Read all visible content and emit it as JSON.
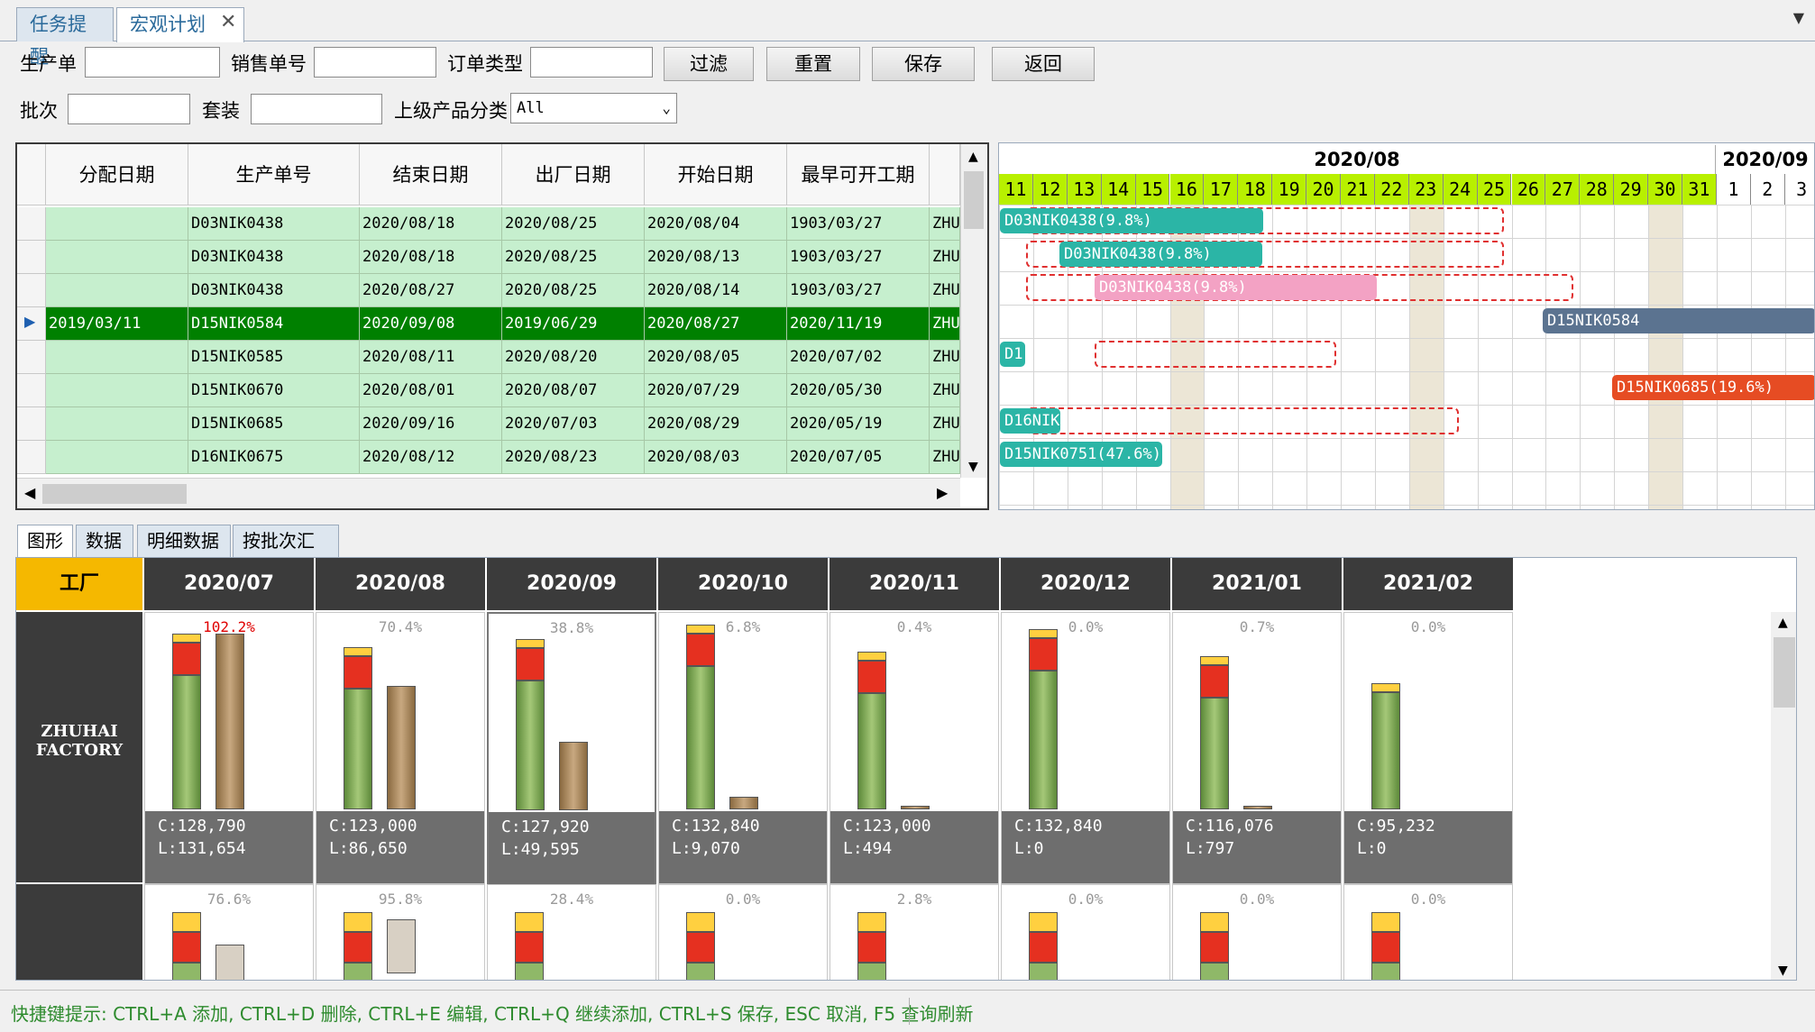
{
  "tabs": [
    {
      "label": "任务提醒"
    },
    {
      "label": "宏观计划"
    }
  ],
  "close_glyph": "✕",
  "filters": {
    "prod_label": "生产单",
    "sales_label": "销售单号",
    "ordertype_label": "订单类型",
    "batch_label": "批次",
    "suit_label": "套装",
    "category_label": "上级产品分类",
    "category_value": "All",
    "prod_value": "",
    "sales_value": "",
    "ordertype_value": "",
    "batch_value": "",
    "suit_value": ""
  },
  "buttons": {
    "filter": "过滤",
    "reset": "重置",
    "save": "保存",
    "back": "返回"
  },
  "grid": {
    "headers": [
      "分配日期",
      "生产单号",
      "结束日期",
      "出厂日期",
      "开始日期",
      "最早可开工期"
    ],
    "rows": [
      [
        "",
        "D03NIK0438",
        "2020/08/18",
        "2020/08/25",
        "2020/08/04",
        "1903/03/27",
        "ZHU"
      ],
      [
        "",
        "D03NIK0438",
        "2020/08/18",
        "2020/08/25",
        "2020/08/13",
        "1903/03/27",
        "ZHU"
      ],
      [
        "",
        "D03NIK0438",
        "2020/08/27",
        "2020/08/25",
        "2020/08/14",
        "1903/03/27",
        "ZHU"
      ],
      [
        "2019/03/11",
        "D15NIK0584",
        "2020/09/08",
        "2019/06/29",
        "2020/08/27",
        "2020/11/19",
        "ZHU"
      ],
      [
        "",
        "D15NIK0585",
        "2020/08/11",
        "2020/08/20",
        "2020/08/05",
        "2020/07/02",
        "ZHU"
      ],
      [
        "",
        "D15NIK0670",
        "2020/08/01",
        "2020/08/07",
        "2020/07/29",
        "2020/05/30",
        "ZHU"
      ],
      [
        "",
        "D15NIK0685",
        "2020/09/16",
        "2020/07/03",
        "2020/08/29",
        "2020/05/19",
        "ZHU"
      ],
      [
        "",
        "D16NIK0675",
        "2020/08/12",
        "2020/08/23",
        "2020/08/03",
        "2020/07/05",
        "ZHU"
      ]
    ],
    "selected_row": 3
  },
  "gantt": {
    "months": [
      "2020/08",
      "2020/09"
    ],
    "days_aug": [
      "11",
      "12",
      "13",
      "14",
      "15",
      "16",
      "17",
      "18",
      "19",
      "20",
      "21",
      "22",
      "23",
      "24",
      "25",
      "26",
      "27",
      "28",
      "29",
      "30",
      "31"
    ],
    "days_sep": [
      "1",
      "2",
      "3"
    ],
    "bars": [
      {
        "label": "D03NIK0438(9.8%)",
        "color": "#2bb5a6"
      },
      {
        "label": "D03NIK0438(9.8%)",
        "color": "#2bb5a6"
      },
      {
        "label": "D03NIK0438(9.8%)",
        "color": "#f3a2c4"
      },
      {
        "label": "D15NIK0584",
        "color": "#5b7390"
      },
      {
        "label": "D1",
        "color": "#2bb5a6"
      },
      {
        "label": "D15NIK0685(19.6%)",
        "color": "#e64c23"
      },
      {
        "label": "D16NIK",
        "color": "#2bb5a6"
      },
      {
        "label": "D15NIK0751(47.6%)",
        "color": "#2bb5a6"
      }
    ]
  },
  "bottom_tabs": [
    "图形",
    "数据",
    "明细数据",
    "按批次汇总"
  ],
  "capacity": {
    "corner": "工厂",
    "factory_line1": "ZHUHAI",
    "factory_line2": "FACTORY",
    "months": [
      "2020/07",
      "2020/08",
      "2020/09",
      "2020/10",
      "2020/11",
      "2020/12",
      "2021/01",
      "2021/02"
    ],
    "row1": [
      {
        "pct": "102.2%",
        "c": "C:128,790",
        "l": "L:131,654",
        "load_frac": 1.0
      },
      {
        "pct": "70.4%",
        "c": "C:123,000",
        "l": "L:86,650",
        "load_frac": 0.7
      },
      {
        "pct": "38.8%",
        "c": "C:127,920",
        "l": "L:49,595",
        "load_frac": 0.39
      },
      {
        "pct": "6.8%",
        "c": "C:132,840",
        "l": "L:9,070",
        "load_frac": 0.07
      },
      {
        "pct": "0.4%",
        "c": "C:123,000",
        "l": "L:494",
        "load_frac": 0.02
      },
      {
        "pct": "0.0%",
        "c": "C:132,840",
        "l": "L:0",
        "load_frac": 0
      },
      {
        "pct": "0.7%",
        "c": "C:116,076",
        "l": "L:797",
        "load_frac": 0.02
      },
      {
        "pct": "0.0%",
        "c": "C:95,232",
        "l": "L:0",
        "load_frac": 0
      }
    ],
    "row2": [
      {
        "pct": "76.6%"
      },
      {
        "pct": "95.8%"
      },
      {
        "pct": "28.4%"
      },
      {
        "pct": "0.0%"
      },
      {
        "pct": "2.8%"
      },
      {
        "pct": "0.0%"
      },
      {
        "pct": "0.0%"
      },
      {
        "pct": "0.0%"
      }
    ]
  },
  "status": {
    "hint": "快捷键提示: CTRL+A 添加, CTRL+D 删除, CTRL+E 编辑, CTRL+Q 继续添加, CTRL+S 保存, ESC 取消, F5 查询刷新"
  }
}
